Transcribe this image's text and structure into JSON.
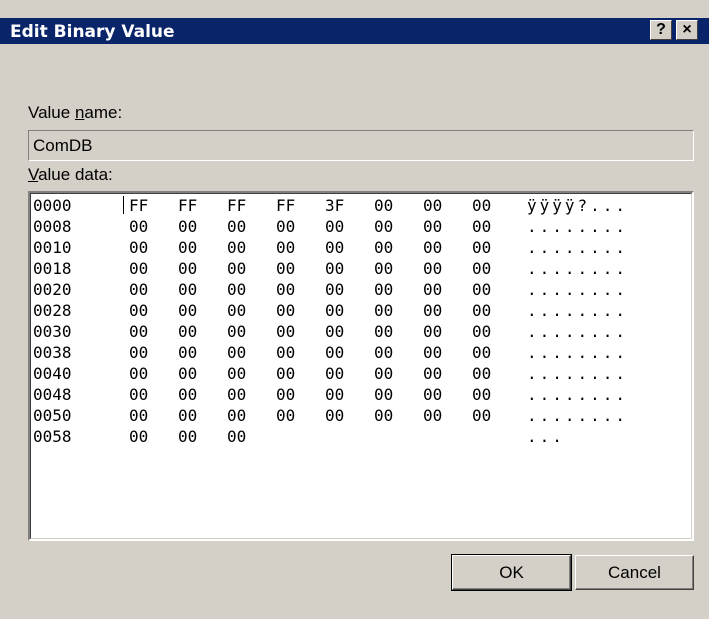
{
  "window": {
    "title": "Edit Binary Value",
    "help_label": "?",
    "close_label": "×"
  },
  "value_name": {
    "label_pre": "Value ",
    "label_accel": "n",
    "label_post": "ame:",
    "value": "ComDB"
  },
  "value_data": {
    "label_accel": "V",
    "label_post": "alue data:",
    "rows": [
      {
        "addr": "0000",
        "hex": [
          "FF",
          "FF",
          "FF",
          "FF",
          "3F",
          "00",
          "00",
          "00"
        ],
        "ascii": "ÿÿÿÿ?..."
      },
      {
        "addr": "0008",
        "hex": [
          "00",
          "00",
          "00",
          "00",
          "00",
          "00",
          "00",
          "00"
        ],
        "ascii": "........"
      },
      {
        "addr": "0010",
        "hex": [
          "00",
          "00",
          "00",
          "00",
          "00",
          "00",
          "00",
          "00"
        ],
        "ascii": "........"
      },
      {
        "addr": "0018",
        "hex": [
          "00",
          "00",
          "00",
          "00",
          "00",
          "00",
          "00",
          "00"
        ],
        "ascii": "........"
      },
      {
        "addr": "0020",
        "hex": [
          "00",
          "00",
          "00",
          "00",
          "00",
          "00",
          "00",
          "00"
        ],
        "ascii": "........"
      },
      {
        "addr": "0028",
        "hex": [
          "00",
          "00",
          "00",
          "00",
          "00",
          "00",
          "00",
          "00"
        ],
        "ascii": "........"
      },
      {
        "addr": "0030",
        "hex": [
          "00",
          "00",
          "00",
          "00",
          "00",
          "00",
          "00",
          "00"
        ],
        "ascii": "........"
      },
      {
        "addr": "0038",
        "hex": [
          "00",
          "00",
          "00",
          "00",
          "00",
          "00",
          "00",
          "00"
        ],
        "ascii": "........"
      },
      {
        "addr": "0040",
        "hex": [
          "00",
          "00",
          "00",
          "00",
          "00",
          "00",
          "00",
          "00"
        ],
        "ascii": "........"
      },
      {
        "addr": "0048",
        "hex": [
          "00",
          "00",
          "00",
          "00",
          "00",
          "00",
          "00",
          "00"
        ],
        "ascii": "........"
      },
      {
        "addr": "0050",
        "hex": [
          "00",
          "00",
          "00",
          "00",
          "00",
          "00",
          "00",
          "00"
        ],
        "ascii": "........"
      },
      {
        "addr": "0058",
        "hex": [
          "00",
          "00",
          "00"
        ],
        "ascii": "..."
      }
    ]
  },
  "buttons": {
    "ok": "OK",
    "cancel": "Cancel"
  }
}
